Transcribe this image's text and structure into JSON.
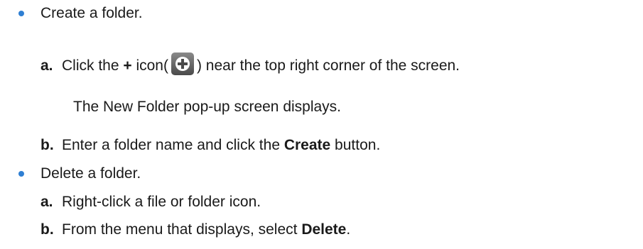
{
  "items": [
    {
      "text": "Create a folder.",
      "steps": {
        "a": {
          "letter": "a.",
          "pre": "Click the ",
          "bold_plus": "+",
          "mid": " icon(",
          "post": ") near the top right corner of the screen.",
          "note": "The New Folder pop-up screen displays."
        },
        "b": {
          "letter": "b.",
          "pre": "Enter a folder name and click the ",
          "bold": "Create",
          "post": " button."
        }
      }
    },
    {
      "text": "Delete a folder.",
      "steps": {
        "a": {
          "letter": "a.",
          "text": "Right-click a file or folder icon."
        },
        "b": {
          "letter": "b.",
          "pre": "From the menu that displays, select ",
          "bold": "Delete",
          "post": "."
        }
      }
    }
  ],
  "colors": {
    "bullet": "#2f7fd3",
    "text": "#1a1a1a",
    "icon_bg": "#5a5a5a"
  },
  "icons": {
    "add": "plus-circle-icon"
  }
}
